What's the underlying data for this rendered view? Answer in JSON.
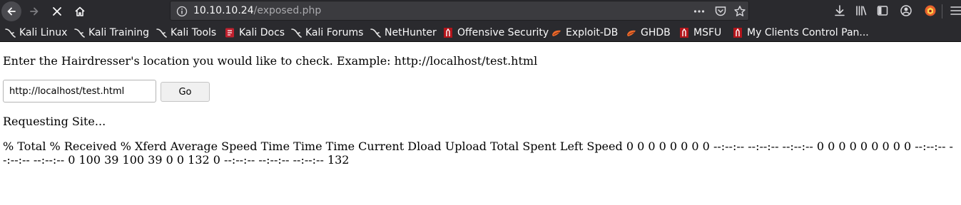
{
  "browser": {
    "url_host": "10.10.10.24",
    "url_path": "/exposed.php",
    "bookmarks": [
      {
        "label": "Kali Linux",
        "icon": "kali-dragon-icon"
      },
      {
        "label": "Kali Training",
        "icon": "kali-dragon-icon"
      },
      {
        "label": "Kali Tools",
        "icon": "kali-dragon-icon"
      },
      {
        "label": "Kali Docs",
        "icon": "kali-docs-icon"
      },
      {
        "label": "Kali Forums",
        "icon": "kali-dragon-icon"
      },
      {
        "label": "NetHunter",
        "icon": "kali-dragon-icon"
      },
      {
        "label": "Offensive Security",
        "icon": "offsec-icon"
      },
      {
        "label": "Exploit-DB",
        "icon": "exploit-db-icon"
      },
      {
        "label": "GHDB",
        "icon": "ghdb-icon"
      },
      {
        "label": "MSFU",
        "icon": "offsec-icon"
      },
      {
        "label": "My Clients Control Pan...",
        "icon": "offsec-icon"
      }
    ],
    "colors": {
      "chrome_bg": "#2a2a2e",
      "urlbar_bg": "#3b3b3f",
      "bookmark_text": "#f9f9fa"
    }
  },
  "page": {
    "prompt": "Enter the Hairdresser's location you would like to check. Example: http://localhost/test.html",
    "input_value": "http://localhost/test.html",
    "go_label": "Go",
    "status": "Requesting Site...",
    "curl_output": "% Total % Received % Xferd Average Speed Time Time Time Current Dload Upload Total Spent Left Speed 0 0 0 0 0 0 0 0 --:--:-- --:--:-- --:--:-- 0 0 0 0 0 0 0 0 0 --:--:-- --:--:-- --:--:-- 0 100 39 100 39 0 0 132 0 --:--:-- --:--:-- --:--:-- 132"
  }
}
